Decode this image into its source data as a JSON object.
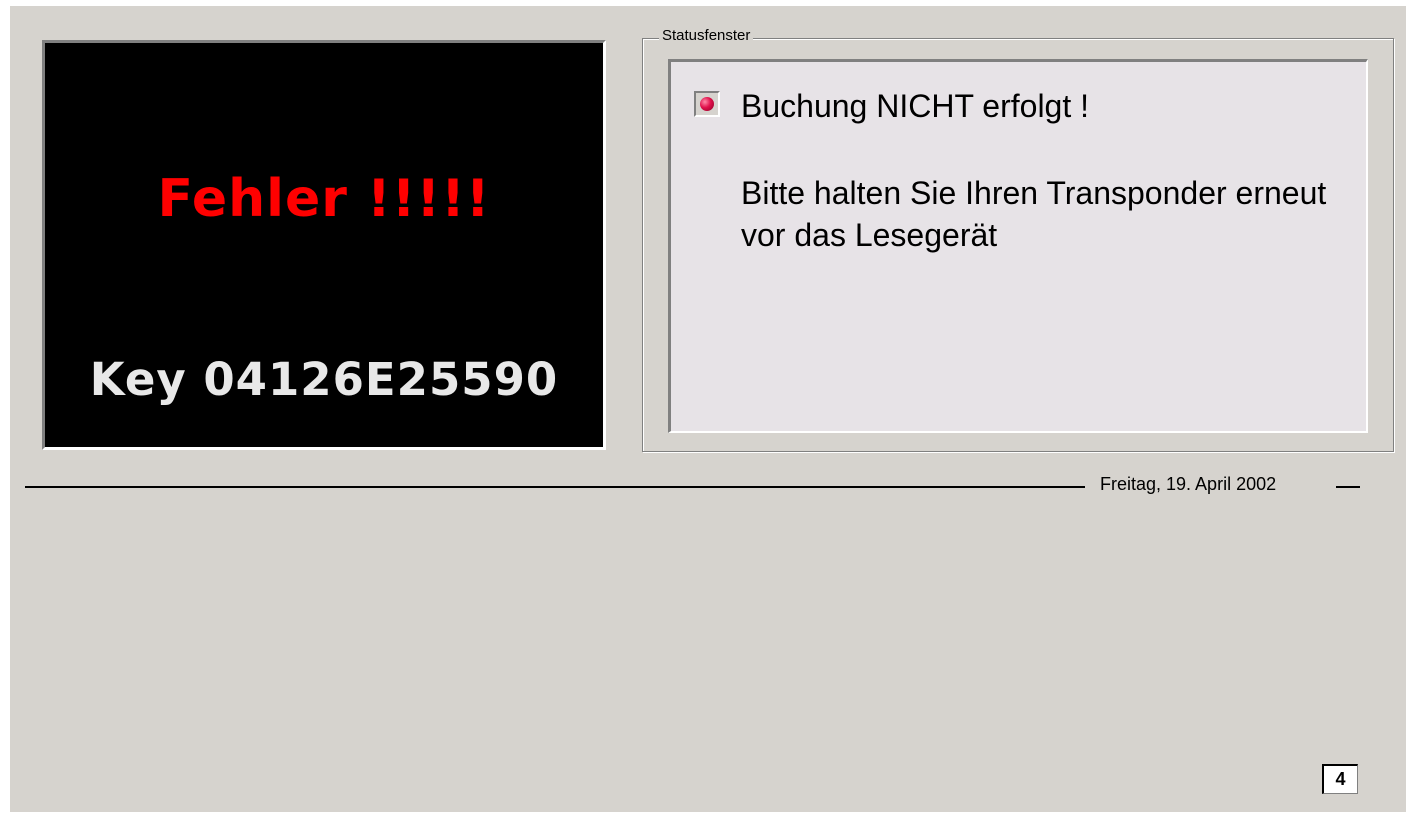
{
  "display": {
    "error_text": "Fehler !!!!!",
    "key_text": "Key 04126E25590",
    "error_color": "#ff0000",
    "background_color": "#000000"
  },
  "status": {
    "legend": "Statusfenster",
    "indicator_icon": "red-led-icon",
    "indicator_color": "#e0104a",
    "title": "Buchung NICHT erfolgt !",
    "message": "Bitte halten Sie Ihren Transponder erneut vor das Lesegerät"
  },
  "date": {
    "text": "Freitag, 19. April 2002"
  },
  "counter": {
    "value": "4"
  }
}
